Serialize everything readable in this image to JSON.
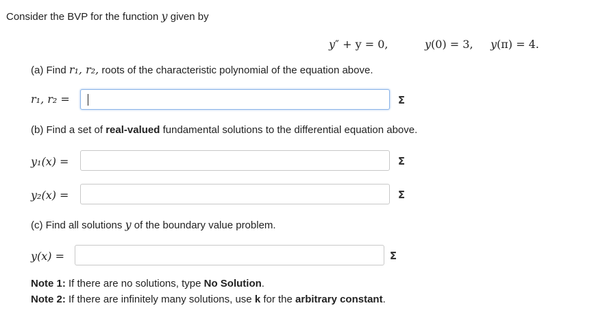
{
  "intro": {
    "text": "Consider the BVP for the function",
    "var": "y",
    "tail": "given by"
  },
  "equation": {
    "ode_y": "y",
    "ode_prime": "″",
    "ode_rest": " + y = 0,",
    "bc1_y": "y",
    "bc1_rest": "(0) = 3,",
    "bc2_y": "y",
    "bc2_rest": "(π) = 4."
  },
  "part_a": {
    "prompt_pre": "(a) Find",
    "vars": "r₁, r₂,",
    "prompt_post": "roots of the characteristic polynomial of the equation above.",
    "field_label": "r₁, r₂ =",
    "input_value": ""
  },
  "part_b": {
    "prompt_pre": "(b) Find a set of",
    "prompt_bold": "real-valued",
    "prompt_post": "fundamental solutions to the differential equation above.",
    "y1_label": "y₁(x) =",
    "y2_label": "y₂(x) =",
    "y1_value": "",
    "y2_value": ""
  },
  "part_c": {
    "prompt_pre": "(c) Find all solutions",
    "var": "y",
    "prompt_post": "of the boundary value problem.",
    "field_label": "y(x) =",
    "input_value": ""
  },
  "notes": {
    "note1_label": "Note 1:",
    "note1_pre": "If there are no solutions, type",
    "note1_bold": "No Solution",
    "note1_end": ".",
    "note2_label": "Note 2:",
    "note2_pre": "If there are infinitely many solutions, use",
    "note2_k": "k",
    "note2_mid": "for the",
    "note2_bold": "arbitrary constant",
    "note2_end": "."
  },
  "icons": {
    "sigma": "Σ"
  }
}
